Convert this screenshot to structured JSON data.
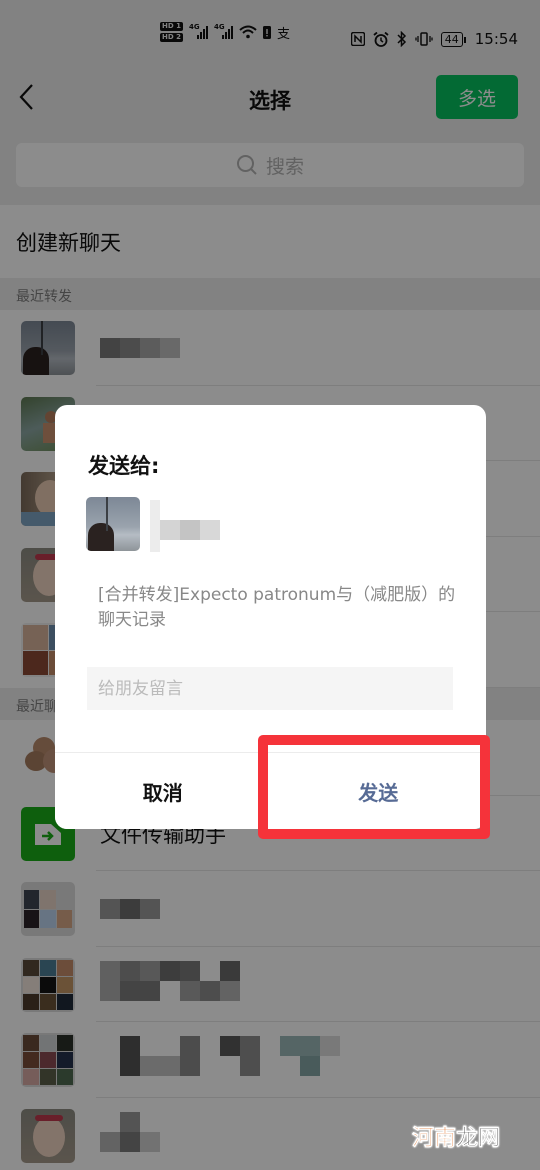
{
  "status_bar": {
    "sim1": "HD 1",
    "sim2": "HD 2",
    "network1": "4G",
    "network2": "4G",
    "battery": "44",
    "time": "15:54",
    "icons": [
      "wifi-icon",
      "battery-saver-icon",
      "input-method-icon",
      "nfc-icon",
      "alarm-icon",
      "bluetooth-icon",
      "vibrate-icon"
    ]
  },
  "navbar": {
    "back_icon": "chevron-left-icon",
    "title": "选择",
    "multi_select_label": "多选",
    "accent": "#07c160"
  },
  "search": {
    "placeholder": "搜索",
    "icon": "search-icon"
  },
  "new_chat_label": "创建新聊天",
  "recent_forward": {
    "header": "最近转发",
    "items": [
      {
        "name": "[blurred]",
        "avatar": "person-by-window"
      },
      {
        "name": "[blurred]",
        "avatar": "child-outdoor"
      },
      {
        "name": "[blurred]",
        "avatar": "girl-portrait"
      },
      {
        "name": "[blurred]",
        "avatar": "girl-with-glasses"
      },
      {
        "name": "[blurred]",
        "avatar": "baby-collage"
      }
    ]
  },
  "recent_chats": {
    "header": "最近聊天",
    "items": [
      {
        "name": "[hidden]",
        "avatar": "cookie-bear"
      },
      {
        "name": "文件传输助手",
        "avatar": "file-transfer-icon"
      },
      {
        "name": "[blurred]",
        "avatar": "group-grid"
      },
      {
        "name": "[blurred]",
        "avatar": "group-grid"
      },
      {
        "name": "[blurred]",
        "avatar": "group-grid"
      },
      {
        "name": "[blurred]",
        "avatar": "girl-with-glasses"
      }
    ]
  },
  "dialog": {
    "title": "发送给:",
    "recipient_name": "[blurred]",
    "message": "[合并转发]Expecto patronum与（减肥版）的聊天记录",
    "comment_value": "",
    "comment_placeholder": "给朋友留言",
    "cancel_label": "取消",
    "send_label": "发送",
    "send_color": "#576b95",
    "highlight_color": "#f5333a"
  },
  "watermark": {
    "part1": "河南",
    "part2": "龙网"
  }
}
